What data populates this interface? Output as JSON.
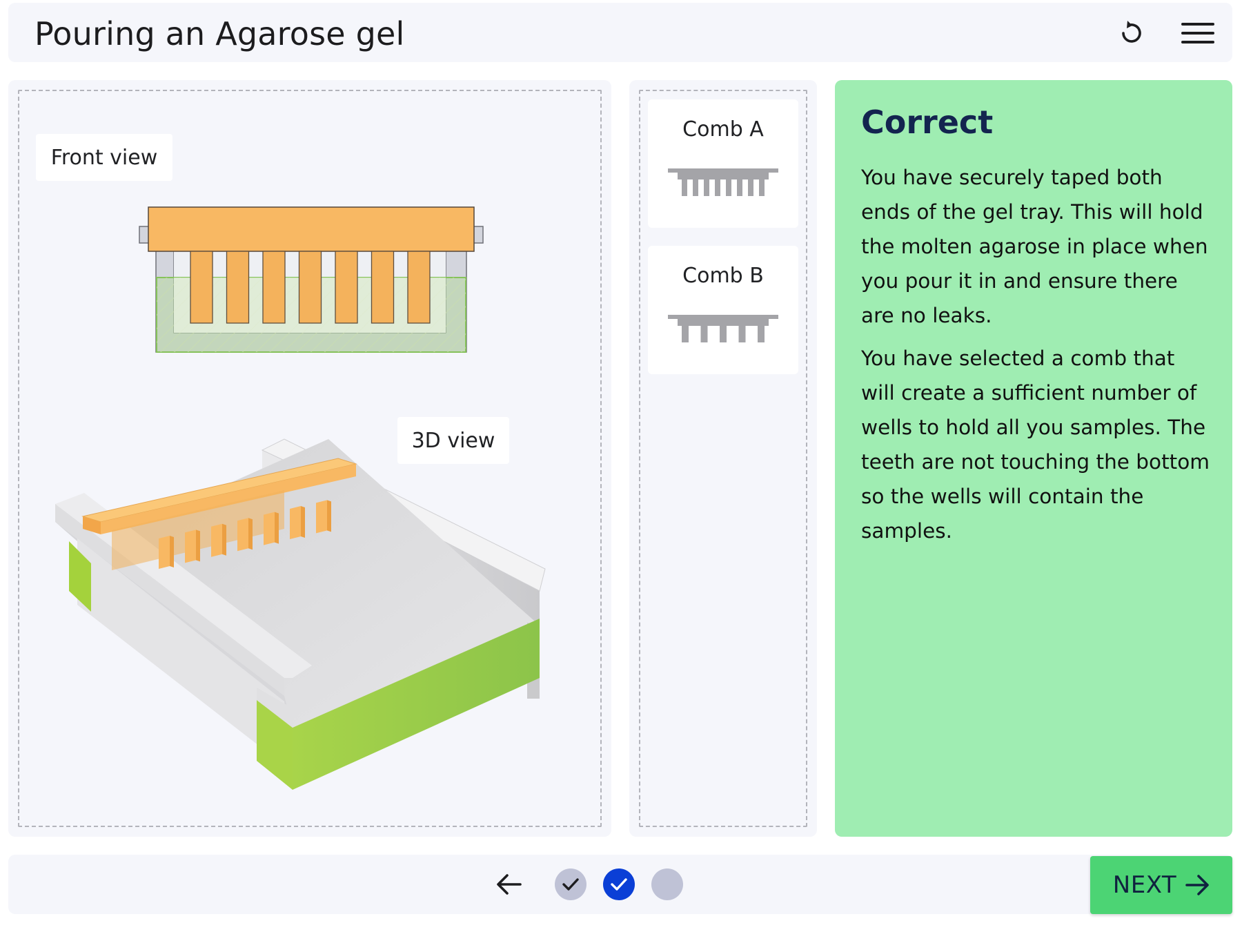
{
  "header": {
    "title": "Pouring an Agarose gel",
    "reset_icon": "reset-icon",
    "menu_icon": "hamburger-menu-icon"
  },
  "workspace": {
    "front_view_label": "Front view",
    "three_d_view_label": "3D view"
  },
  "comb_tray": {
    "combs": [
      {
        "label": "Comb A",
        "teeth": 8
      },
      {
        "label": "Comb B",
        "teeth": 5
      }
    ]
  },
  "feedback": {
    "heading": "Correct",
    "paragraphs": [
      "You have securely taped both ends of the gel tray. This will hold the molten agarose in place when you pour it in and ensure there are no leaks.",
      "You have selected a comb that will create a sufficient number of wells to hold all you samples. The teeth are not touching the bottom so the wells will contain the samples."
    ]
  },
  "footer": {
    "back_icon": "arrow-left-icon",
    "steps": [
      {
        "state": "complete"
      },
      {
        "state": "current-complete"
      },
      {
        "state": "incomplete"
      }
    ],
    "next_label": "NEXT",
    "next_icon": "arrow-right-icon"
  },
  "colors": {
    "accent_blue": "#0b3fd6",
    "success_green": "#4cd474",
    "feedback_bg": "#9fedb2",
    "comb_orange": "#f8b863",
    "tape_green": "#8fcc3c",
    "panel_bg": "#f5f6fb"
  }
}
